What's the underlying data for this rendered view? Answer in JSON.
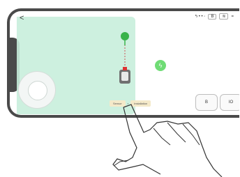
{
  "header": {
    "back": "<"
  },
  "status": {
    "items": [
      "B",
      "="
    ]
  },
  "buttons": {
    "left": "B",
    "right": "IO"
  },
  "toast": {
    "left": "Sensor",
    "right": "Installation"
  },
  "colors": {
    "map": "#c8eedc",
    "accent": "#3cb35e",
    "frame": "#4a4a4a"
  },
  "icons": {
    "bolt": "green-bolt-icon",
    "pin": "location-pin-icon"
  }
}
